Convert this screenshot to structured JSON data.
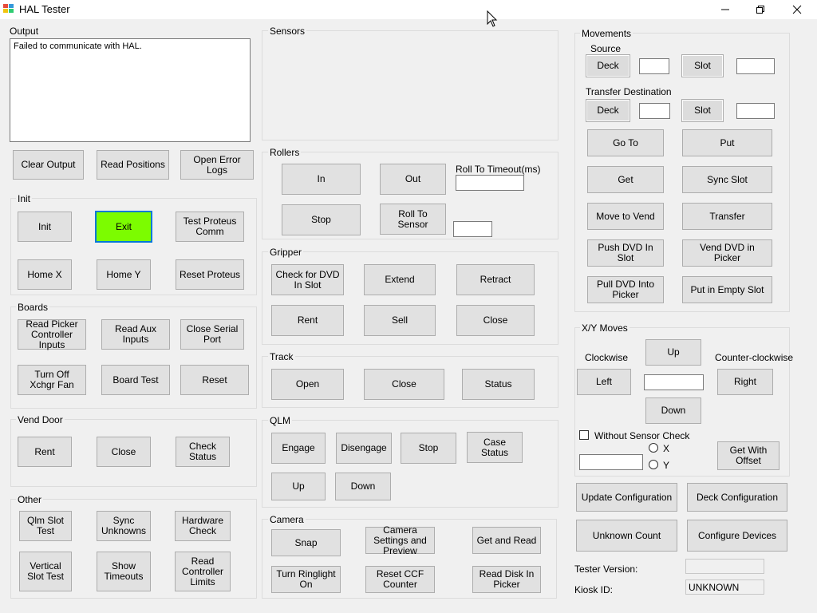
{
  "window": {
    "title": "HAL Tester"
  },
  "output": {
    "label": "Output",
    "text": "Failed to communicate with HAL."
  },
  "top_buttons": {
    "clear": "Clear Output",
    "read_positions": "Read Positions",
    "open_errors": "Open Error Logs"
  },
  "init": {
    "label": "Init",
    "init": "Init",
    "exit": "Exit",
    "test_proteus": "Test Proteus Comm",
    "home_x": "Home X",
    "home_y": "Home Y",
    "reset_proteus": "Reset Proteus"
  },
  "boards": {
    "label": "Boards",
    "read_picker": "Read Picker Controller Inputs",
    "read_aux": "Read Aux Inputs",
    "close_serial": "Close Serial Port",
    "turn_off_fan": "Turn Off Xchgr Fan",
    "board_test": "Board Test",
    "reset": "Reset"
  },
  "vend_door": {
    "label": "Vend Door",
    "rent": "Rent",
    "close": "Close",
    "check_status": "Check Status"
  },
  "other": {
    "label": "Other",
    "qlm_slot_test": "Qlm Slot Test",
    "sync_unknowns": "Sync Unknowns",
    "hardware_check": "Hardware Check",
    "vertical_slot_test": "Vertical Slot Test",
    "show_timeouts": "Show Timeouts",
    "read_controller_limits": "Read Controller Limits"
  },
  "sensors": {
    "label": "Sensors"
  },
  "rollers": {
    "label": "Rollers",
    "in": "In",
    "out": "Out",
    "stop": "Stop",
    "roll_to_sensor": "Roll To Sensor",
    "timeout_label": "Roll To Timeout(ms)",
    "timeout_value": "",
    "sensor_value": ""
  },
  "gripper": {
    "label": "Gripper",
    "check_dvd": "Check for DVD In Slot",
    "extend": "Extend",
    "retract": "Retract",
    "rent": "Rent",
    "sell": "Sell",
    "close": "Close"
  },
  "track": {
    "label": "Track",
    "open": "Open",
    "close": "Close",
    "status": "Status"
  },
  "qlm": {
    "label": "QLM",
    "engage": "Engage",
    "disengage": "Disengage",
    "stop": "Stop",
    "case_status": "Case Status",
    "up": "Up",
    "down": "Down"
  },
  "camera": {
    "label": "Camera",
    "snap": "Snap",
    "settings_preview": "Camera Settings and Preview",
    "get_and_read": "Get and Read",
    "turn_ringlight_on": "Turn Ringlight On",
    "reset_ccf": "Reset CCF Counter",
    "read_disk": "Read Disk In Picker"
  },
  "movements": {
    "label": "Movements",
    "source_label": "Source",
    "transfer_dest_label": "Transfer Destination",
    "deck": "Deck",
    "slot": "Slot",
    "source_deck_value": "",
    "source_slot_value": "",
    "dest_deck_value": "",
    "dest_slot_value": "",
    "go_to": "Go To",
    "put": "Put",
    "get": "Get",
    "sync_slot": "Sync Slot",
    "move_to_vend": "Move to Vend",
    "transfer": "Transfer",
    "push_dvd": "Push DVD In Slot",
    "vend_dvd": "Vend DVD in Picker",
    "pull_dvd": "Pull DVD Into Picker",
    "put_empty": "Put in Empty Slot"
  },
  "xy_moves": {
    "label": "X/Y Moves",
    "clockwise": "Clockwise",
    "counter_clockwise": "Counter-clockwise",
    "up": "Up",
    "left": "Left",
    "right": "Right",
    "down": "Down",
    "step_value": "",
    "without_sensor_check": "Without Sensor Check",
    "x_label": "X",
    "y_label": "Y",
    "get_with_offset": "Get With Offset",
    "offset_value": ""
  },
  "config": {
    "update": "Update Configuration",
    "deck": "Deck Configuration",
    "unknown_count": "Unknown Count",
    "configure_devices": "Configure Devices"
  },
  "info": {
    "tester_version_label": "Tester Version:",
    "tester_version_value": "",
    "kiosk_id_label": "Kiosk ID:",
    "kiosk_id_value": "UNKNOWN"
  },
  "colors": {
    "exit_button": "#7cfc00",
    "focus_border": "#0078d7"
  }
}
